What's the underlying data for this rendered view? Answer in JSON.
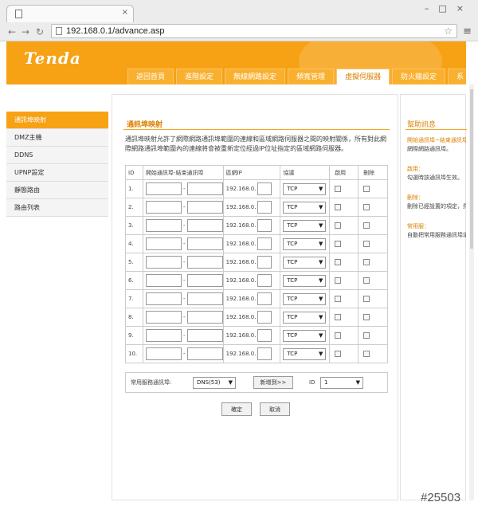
{
  "browser": {
    "url": "192.168.0.1/advance.asp"
  },
  "header": {
    "logo": "Tenda",
    "tabs": [
      {
        "label": "返回首頁"
      },
      {
        "label": "進階設定"
      },
      {
        "label": "無線網路設定"
      },
      {
        "label": "頻寬管理"
      },
      {
        "label": "虛擬伺服器",
        "active": true
      },
      {
        "label": "防火牆設定"
      },
      {
        "label": "系"
      }
    ]
  },
  "sidebar": {
    "items": [
      {
        "label": "通訊埠映射",
        "active": true
      },
      {
        "label": "DMZ主機"
      },
      {
        "label": "DDNS"
      },
      {
        "label": "UPNP設定"
      },
      {
        "label": "靜態路由"
      },
      {
        "label": "路由列表"
      }
    ]
  },
  "main": {
    "title": "通訊埠映射",
    "description": "通訊埠映射允許了網際網路通訊埠範圍的連線和區域網路伺服器之間的映射關係，所有對此網際網路通訊埠範圍內的連線將會被重新定位經過IP位址指定的區域網路伺服器。",
    "columns": {
      "id": "ID",
      "ports": "開始通訊埠-結束通訊埠",
      "lan_ip": "區網IP",
      "protocol": "協議",
      "enable": "啟用",
      "delete": "刪除"
    },
    "rows": [
      {
        "id": "1.",
        "ip_prefix": "192.168.0.",
        "protocol": "TCP"
      },
      {
        "id": "2.",
        "ip_prefix": "192.168.0.",
        "protocol": "TCP"
      },
      {
        "id": "3.",
        "ip_prefix": "192.168.0.",
        "protocol": "TCP"
      },
      {
        "id": "4.",
        "ip_prefix": "192.168.0.",
        "protocol": "TCP"
      },
      {
        "id": "5.",
        "ip_prefix": "192.168.0.",
        "protocol": "TCP"
      },
      {
        "id": "6.",
        "ip_prefix": "192.168.0.",
        "protocol": "TCP"
      },
      {
        "id": "7.",
        "ip_prefix": "192.168.0.",
        "protocol": "TCP"
      },
      {
        "id": "8.",
        "ip_prefix": "192.168.0.",
        "protocol": "TCP"
      },
      {
        "id": "9.",
        "ip_prefix": "192.168.0.",
        "protocol": "TCP"
      },
      {
        "id": "10.",
        "ip_prefix": "192.168.0.",
        "protocol": "TCP"
      }
    ],
    "port_separator": "-",
    "common": {
      "label": "常用服務通訊埠:",
      "service": "DNS(53)",
      "add_button": "新增到>>",
      "id_label": "ID",
      "id_value": "1"
    },
    "ok_button": "確定",
    "cancel_button": "取消"
  },
  "help": {
    "title": "幫助訊息",
    "blocks": [
      {
        "hl": "開始通訊埠~結束通訊埠",
        "text": "網際網路通訊埠。"
      },
      {
        "hl": "啟用：",
        "text": "勾選時該通訊埠生效。"
      },
      {
        "hl": "刪除：",
        "text": "刪除已經設置的項定，然後儲存設定。"
      },
      {
        "hl": "常用服：",
        "text": "自動把常用服務通訊埠填到列表目中。"
      }
    ]
  },
  "watermark": "#25503"
}
